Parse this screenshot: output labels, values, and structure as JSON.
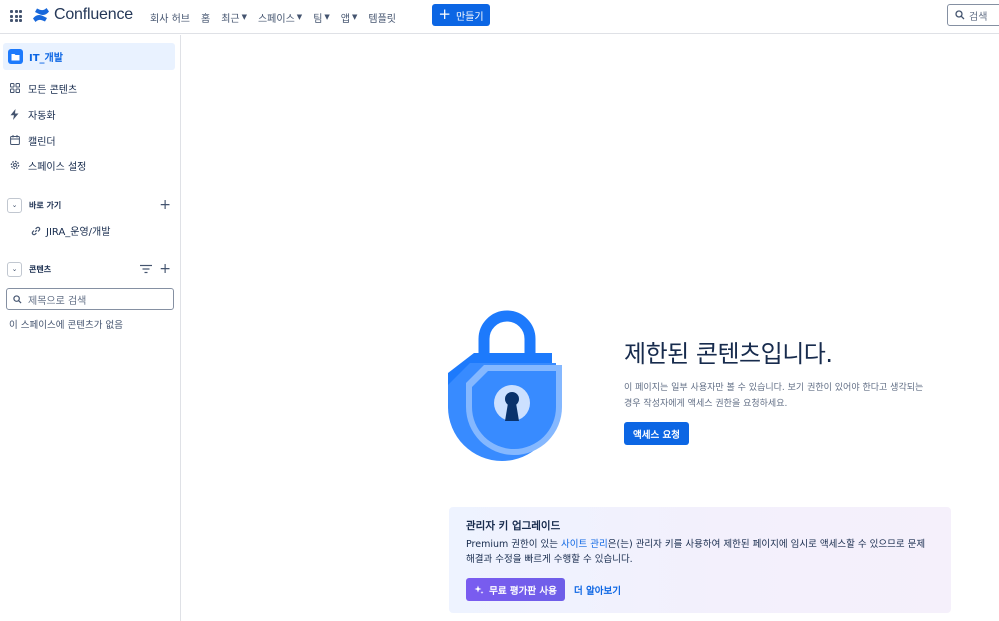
{
  "topnav": {
    "logo": "Confluence",
    "items": [
      {
        "label": "회사 허브",
        "has_dropdown": false
      },
      {
        "label": "홈",
        "has_dropdown": false
      },
      {
        "label": "최근",
        "has_dropdown": true
      },
      {
        "label": "스페이스",
        "has_dropdown": true
      },
      {
        "label": "팀",
        "has_dropdown": true
      },
      {
        "label": "앱",
        "has_dropdown": true
      },
      {
        "label": "템플릿",
        "has_dropdown": false
      }
    ],
    "create_label": "만들기",
    "search_placeholder": "검색"
  },
  "sidebar": {
    "space_name": "IT_개발",
    "items": [
      {
        "label": "모든 콘텐츠",
        "icon": "grid-icon"
      },
      {
        "label": "자동화",
        "icon": "lightning-icon"
      },
      {
        "label": "캘린더",
        "icon": "calendar-icon"
      },
      {
        "label": "스페이스 설정",
        "icon": "gear-icon"
      }
    ],
    "shortcuts_label": "바로 가기",
    "shortcut_item": "JIRA_운영/개발",
    "content_label": "콘텐츠",
    "filter_placeholder": "제목으로 검색",
    "empty_note": "이 스페이스에 콘텐츠가 없음"
  },
  "main": {
    "title": "제한된 콘텐츠입니다.",
    "description": "이 페이지는 일부 사용자만 볼 수 있습니다. 보기 권한이 있어야 한다고 생각되는 경우 작성자에게 액세스 권한을 요청하세요.",
    "request_button": "액세스 요청",
    "upgrade": {
      "title": "관리자 키 업그레이드",
      "body_prefix": "Premium 권한이 있는 ",
      "body_link": "사이트 관리",
      "body_suffix": "은(는) 관리자 키를 사용하여 제한된 페이지에 임시로 액세스할 수 있으므로 문제 해결과 수정을 빠르게 수행할 수 있습니다.",
      "trial_button": "무료 평가판 사용",
      "learn_more": "더 알아보기"
    }
  },
  "colors": {
    "brand": "#0c66e4",
    "lock_dark": "#1d7afc",
    "lock_light": "#579dff",
    "trial": "#6e5dc6"
  }
}
